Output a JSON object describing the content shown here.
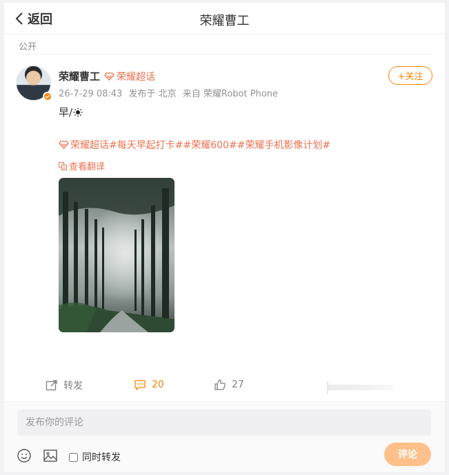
{
  "header": {
    "back_label": "返回",
    "title": "荣耀曹工"
  },
  "post": {
    "visibility": "公开",
    "author": {
      "name": "荣耀曹工",
      "super_topic": "荣耀超话"
    },
    "meta": {
      "time": "26-7-29 08:43",
      "location": "发布于 北京",
      "source": "来自 荣耀Robot Phone"
    },
    "follow_label": "+关注",
    "text": "早/",
    "topics": {
      "super_topic": "荣耀超话",
      "tags": [
        "#每天早起打卡#",
        "#荣耀600#",
        "#荣耀手机影像计划#"
      ]
    },
    "translate_label": "查看翻译",
    "image_alt": "foggy forest road photo"
  },
  "actions": {
    "repost_label": "转发",
    "comment_count": "20",
    "like_count": "27"
  },
  "comment_box": {
    "placeholder": "发布你的评论",
    "repost_label": "同时转发",
    "submit_label": "评论"
  },
  "colors": {
    "accent": "#ff8200",
    "topic": "#eb7350",
    "submit_disabled": "#ffc08a"
  },
  "icons": [
    "chevron-left-icon",
    "verified-badge-icon",
    "super-topic-diamond-icon",
    "sun-icon",
    "translate-icon",
    "repost-icon",
    "comment-icon",
    "like-icon",
    "emoji-icon",
    "image-icon"
  ]
}
